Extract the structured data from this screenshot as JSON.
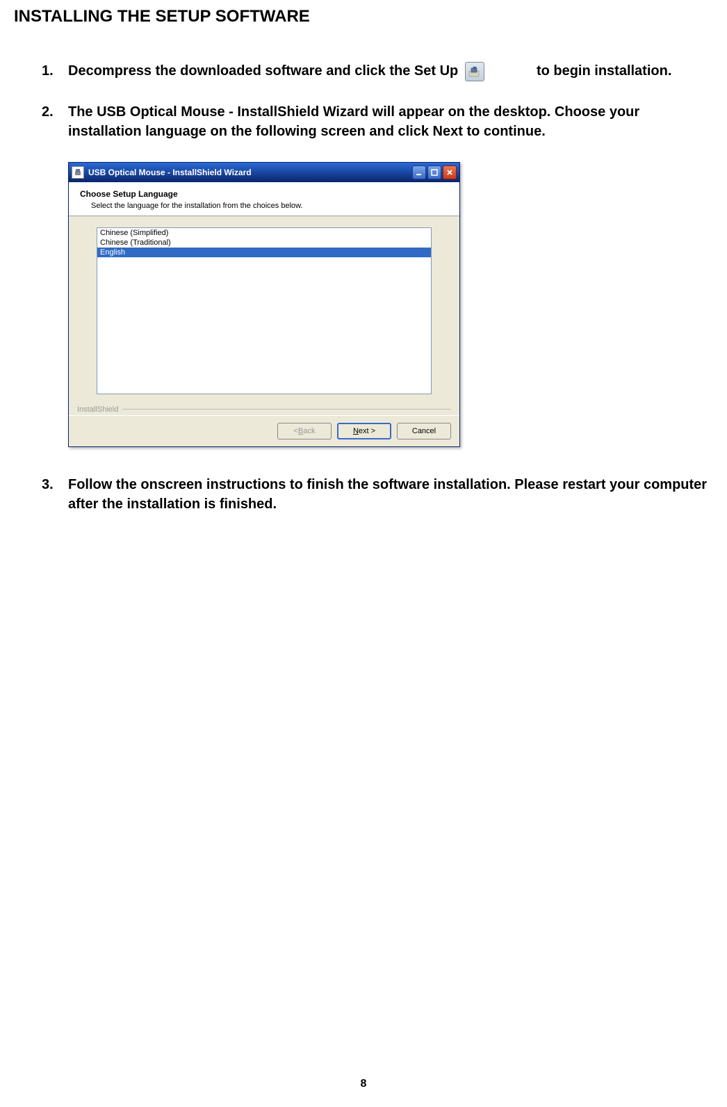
{
  "heading": "INSTALLING THE SETUP SOFTWARE",
  "steps": {
    "s1": {
      "num": "1.",
      "text_before": "Decompress the downloaded software and click the Set Up",
      "text_after": "to begin installation."
    },
    "s2": {
      "num": "2.",
      "text": "The USB Optical Mouse - InstallShield Wizard will appear on the desktop. Choose your installation language on the following screen and click Next to continue."
    },
    "s3": {
      "num": "3.",
      "text": "Follow the onscreen instructions to finish the software installation. Please restart your computer after the installation is finished."
    }
  },
  "dialog": {
    "title": "USB Optical Mouse - InstallShield Wizard",
    "header_title": "Choose Setup Language",
    "header_sub": "Select the language for the installation from the choices below.",
    "list": {
      "items": [
        "Chinese (Simplified)",
        "Chinese (Traditional)",
        "English"
      ],
      "selected_index": 2
    },
    "brand": "InstallShield",
    "buttons": {
      "back": "< Back",
      "next": "Next >",
      "cancel": "Cancel"
    }
  },
  "page_number": "8"
}
